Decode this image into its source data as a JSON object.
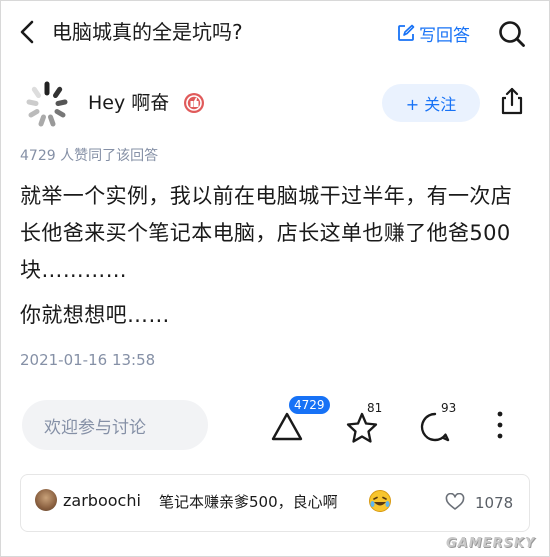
{
  "header": {
    "question_title": "电脑城真的全是坑吗?",
    "write_answer_label": "写回答"
  },
  "author": {
    "name": "Hey 啊奋",
    "follow_label": "+ 关注"
  },
  "answer": {
    "likes_line": "4729 人赞同了该回答",
    "paragraphs": [
      "就举一个实例，我以前在电脑城干过半年，有一次店长他爸来买个笔记本电脑，店长这单也赚了他爸500块…………",
      "你就想想吧……"
    ],
    "timestamp": "2021-01-16 13:58"
  },
  "actions": {
    "comment_placeholder": "欢迎参与讨论",
    "upvote_count": "4729",
    "favorite_count": "81",
    "comment_count": "93"
  },
  "top_comment": {
    "user": "zarboochi",
    "text": "笔记本赚亲爹500，良心啊",
    "emoji": "rolling-laughing-emoji",
    "like_count": "1078"
  },
  "watermark": "GAMERSKY",
  "colors": {
    "accent": "#1772f6",
    "secondary_text": "#8590a6",
    "follow_bg": "#eaf2fe"
  }
}
